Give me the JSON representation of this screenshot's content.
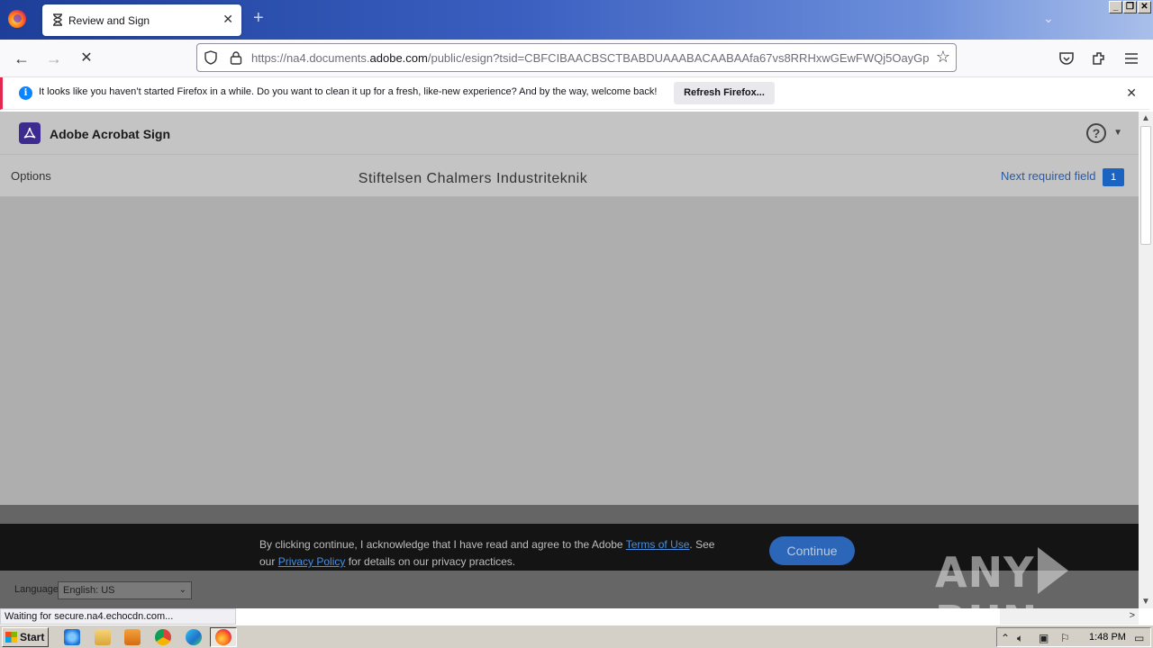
{
  "browser": {
    "tab_title": "Review and Sign",
    "url_prefix": "https://na4.documents.",
    "url_domain": "adobe.com",
    "url_suffix": "/public/esign?tsid=CBFCIBAACBSCTBABDUAAABACAABAAfa67vs8RRHxwGEwFWQj5OayGplqV-XD",
    "status_text": "Waiting for secure.na4.echocdn.com..."
  },
  "notification": {
    "message": "It looks like you haven’t started Firefox in a while. Do you want to clean it up for a fresh, like-new experience? And by the way, welcome back!",
    "button_label": "Refresh Firefox..."
  },
  "app": {
    "title": "Adobe Acrobat Sign",
    "options_label": "Options",
    "organization": "Stiftelsen Chalmers Industriteknik",
    "next_field_label": "Next required field",
    "next_field_count": "1"
  },
  "consent": {
    "text_before_terms": "By clicking continue, I acknowledge that I have read and agree to the Adobe ",
    "terms_link": "Terms of Use",
    "text_after_terms": ". See our ",
    "privacy_link": "Privacy Policy",
    "text_end": " for details on our privacy practices.",
    "continue_label": "Continue"
  },
  "footer": {
    "language_label": "Language",
    "language_value": "English: US"
  },
  "watermark": {
    "left": "ANY",
    "right": "RUN"
  },
  "taskbar": {
    "start_label": "Start",
    "clock": "1:48 PM"
  },
  "colors": {
    "accent": "#1b63c1",
    "notification_border": "#e22850",
    "continue_button": "#2b66b8"
  }
}
